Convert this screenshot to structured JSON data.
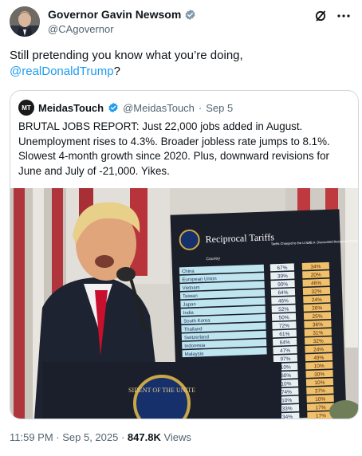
{
  "tweet": {
    "author_name": "Governor Gavin Newsom",
    "author_handle": "@CAgovernor",
    "text": "Still pretending you know what you’re doing,",
    "mention": "@realDonaldTrump",
    "text_suffix": "?",
    "timestamp": "11:59 PM · Sep 5, 2025 ·",
    "views_count": "847.8K",
    "views_label": "Views"
  },
  "header_icons": [
    "grok-icon",
    "more-icon"
  ],
  "quoted_tweet": {
    "avatar_text": "MT",
    "author_name": "MeidasTouch",
    "author_handle": "@MeidasTouch",
    "separator": "·",
    "date": "Sep 5",
    "text": "BRUTAL JOBS REPORT: Just 22,000 jobs added in August. Unemployment rises to 4.3%. Broader jobless rate jumps to 8.1%. Slowest 4-month growth since 2020. Plus, downward revisions for June and July of -21,000. Yikes."
  },
  "board": {
    "title": "Reciprocal Tariffs",
    "col_country": "Country",
    "col_charged": "Tariffs Charged to the U.S.A.",
    "col_reciprocal": "U.S.A. Discounted Reciprocal Tariffs",
    "rows": [
      {
        "country": "China",
        "charged": "67%",
        "reciprocal": "34%"
      },
      {
        "country": "European Union",
        "charged": "39%",
        "reciprocal": "20%"
      },
      {
        "country": "Vietnam",
        "charged": "90%",
        "reciprocal": "46%"
      },
      {
        "country": "Taiwan",
        "charged": "64%",
        "reciprocal": "32%"
      },
      {
        "country": "Japan",
        "charged": "46%",
        "reciprocal": "24%"
      },
      {
        "country": "India",
        "charged": "52%",
        "reciprocal": "26%"
      },
      {
        "country": "South Korea",
        "charged": "50%",
        "reciprocal": "25%"
      },
      {
        "country": "Thailand",
        "charged": "72%",
        "reciprocal": "36%"
      },
      {
        "country": "Switzerland",
        "charged": "61%",
        "reciprocal": "31%"
      },
      {
        "country": "Indonesia",
        "charged": "64%",
        "reciprocal": "32%"
      },
      {
        "country": "Malaysia",
        "charged": "47%",
        "reciprocal": "24%"
      },
      {
        "country": "",
        "charged": "97%",
        "reciprocal": "49%"
      },
      {
        "country": "",
        "charged": "10%",
        "reciprocal": "10%"
      },
      {
        "country": "",
        "charged": "60%",
        "reciprocal": "30%"
      },
      {
        "country": "",
        "charged": "10%",
        "reciprocal": "10%"
      },
      {
        "country": "",
        "charged": "74%",
        "reciprocal": "37%"
      },
      {
        "country": "",
        "charged": "10%",
        "reciprocal": "10%"
      },
      {
        "country": "",
        "charged": "33%",
        "reciprocal": "17%"
      },
      {
        "country": "",
        "charged": "34%",
        "reciprocal": "17%"
      }
    ]
  },
  "podium_seal_text": "SIDENT OF THE UNITE",
  "colors": {
    "text": "#0f1419",
    "secondary": "#536471",
    "link": "#1d9bf0",
    "verified_gold": "#d4a017",
    "verified_gray": "#829aab",
    "board_bg": "#1b1f2a",
    "row_cyan": "#bfe6f0",
    "charged_bg": "#e8f0f2",
    "reciprocal_bg": "#f0c16a"
  }
}
